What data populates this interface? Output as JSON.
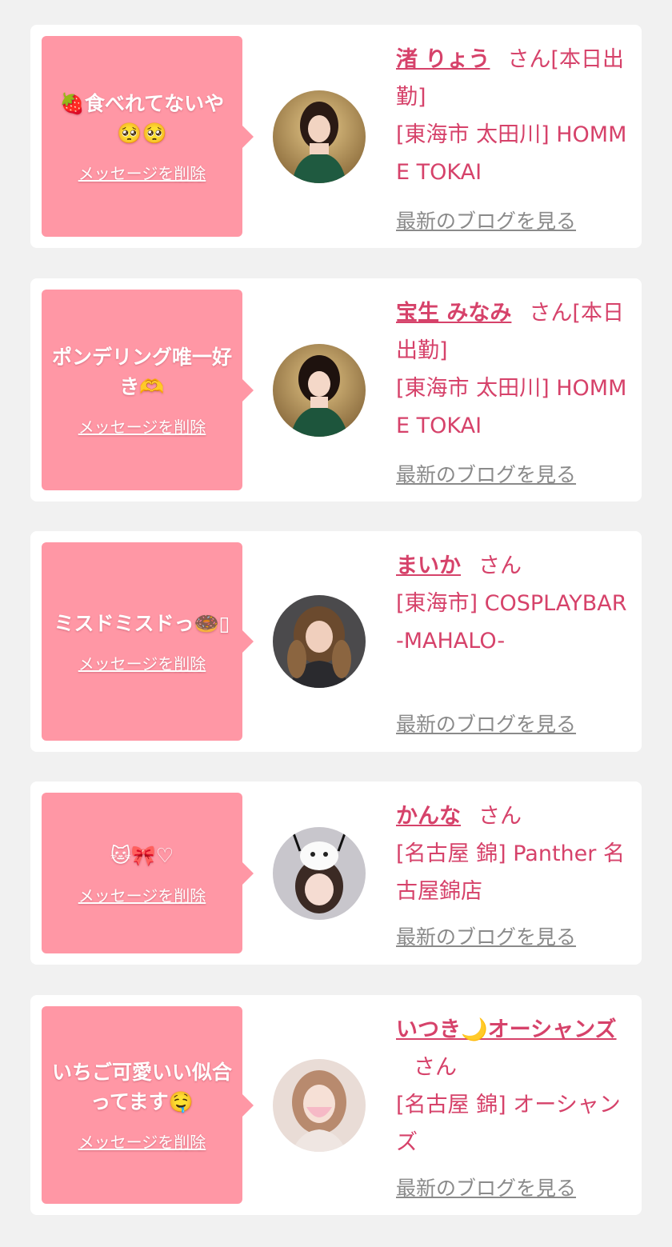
{
  "messages": [
    {
      "message": "🍓食べれてないや🥺🥺",
      "delete_label": "メッセージを削除",
      "name": "渚 りょう",
      "honorific": "さん[本日出勤]",
      "shop": "[東海市 太田川] HOMME TOKAI",
      "blog_label": "最新のブログを見る"
    },
    {
      "message": "ポンデリング唯一好き🫶",
      "delete_label": "メッセージを削除",
      "name": "宝生 みなみ",
      "honorific": "さん[本日出勤]",
      "shop": "[東海市 太田川] HOMME TOKAI",
      "blog_label": "最新のブログを見る"
    },
    {
      "message": "ミスドミスドっ🍩▯",
      "delete_label": "メッセージを削除",
      "name": "まいか",
      "honorific": "さん",
      "shop": "[東海市] COSPLAYBAR -MAHALO-",
      "blog_label": "最新のブログを見る"
    },
    {
      "message": "🐱🎀♡",
      "delete_label": "メッセージを削除",
      "name": "かんな",
      "honorific": "さん",
      "shop": "[名古屋 錦] Panther 名古屋錦店",
      "blog_label": "最新のブログを見る"
    },
    {
      "message": "いちご可愛いい似合ってます🤤",
      "delete_label": "メッセージを削除",
      "name": "いつき🌙オーシャンズ",
      "honorific": "さん",
      "shop": "[名古屋 錦] オーシャンズ",
      "blog_label": "最新のブログを見る"
    }
  ]
}
